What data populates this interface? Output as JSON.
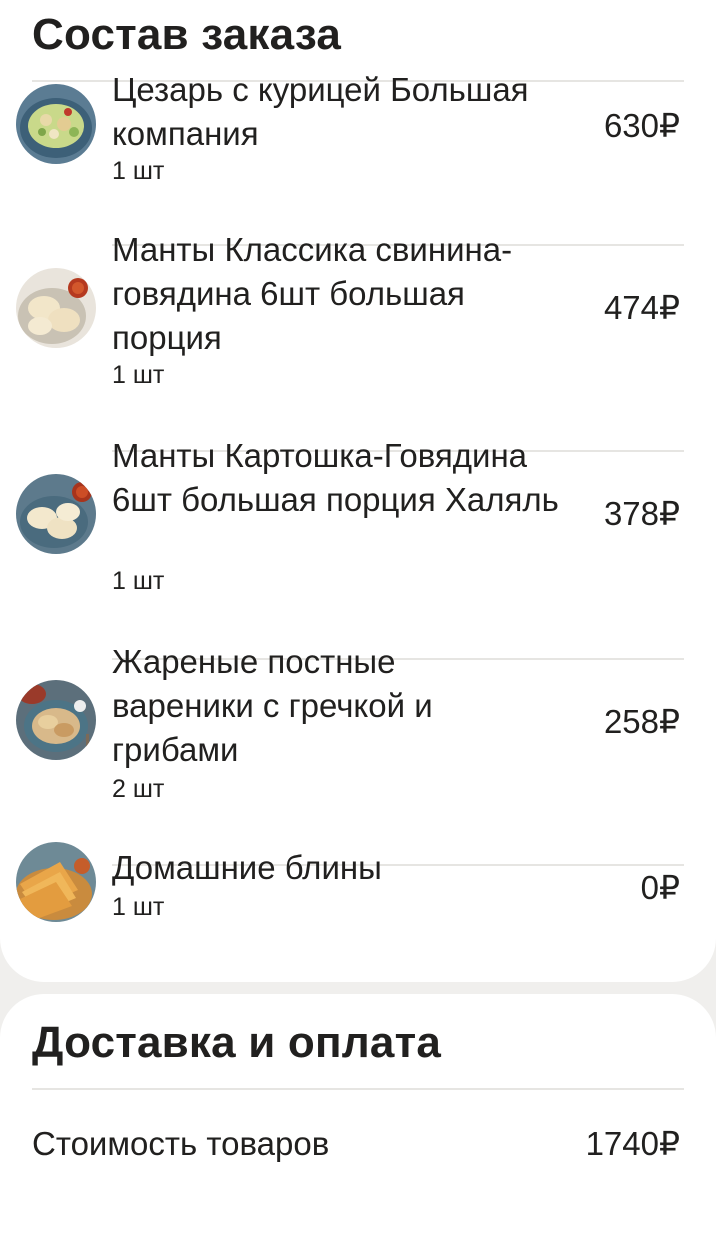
{
  "order": {
    "title": "Состав заказа",
    "items": [
      {
        "name": "Цезарь с курицей Большая компания",
        "qty": "1 шт",
        "price": "630₽",
        "image": "caesar-salad-image"
      },
      {
        "name": "Манты Классика свинина-говядина 6шт большая порция",
        "qty": "1 шт",
        "price": "474₽",
        "image": "manty-image"
      },
      {
        "name": "Манты Картошка-Говядина 6шт большая порция Халяль",
        "qty": "1 шт",
        "price": "378₽",
        "image": "manty-halal-image"
      },
      {
        "name": "Жареные постные вареники с гречкой и грибами",
        "qty": "2 шт",
        "price": "258₽",
        "image": "vareniki-image"
      },
      {
        "name": "Домашние блины",
        "qty": "1 шт",
        "price": "0₽",
        "image": "pancakes-image"
      }
    ]
  },
  "delivery": {
    "title": "Доставка и оплата",
    "goods_cost_label": "Стоимость товаров",
    "goods_cost_value": "1740₽"
  }
}
